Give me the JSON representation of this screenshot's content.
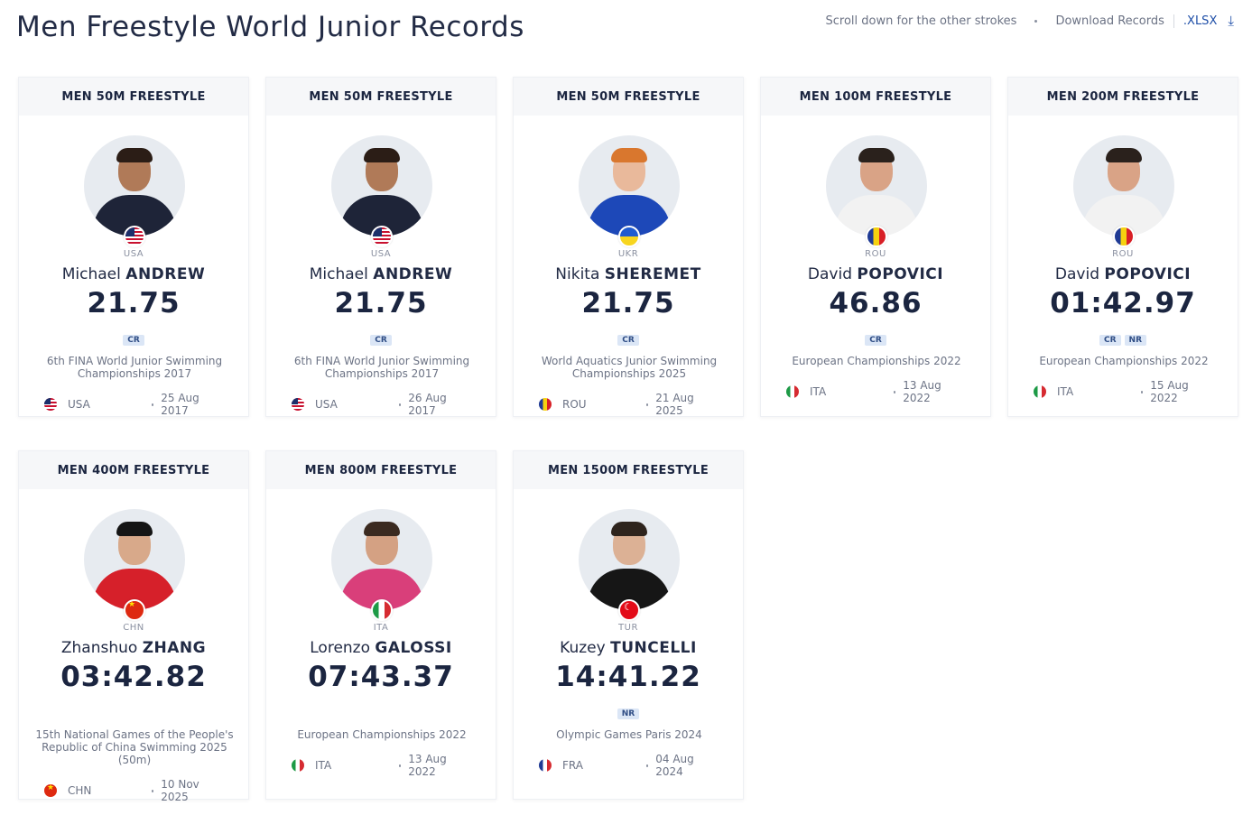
{
  "page": {
    "title": "Men Freestyle World Junior Records",
    "scroll_hint": "Scroll down for the other strokes",
    "download_label": "Download Records",
    "download_format": ".XLSX",
    "download_icon": "download-icon"
  },
  "cards": [
    {
      "discipline": "MEN 50M FREESTYLE",
      "country": "USA",
      "first": "Michael",
      "last": "ANDREW",
      "time": "21.75",
      "badges": [
        "CR"
      ],
      "event": "6th FINA World Junior Swimming Championships 2017",
      "venue_country": "USA",
      "date": "25 Aug 2017",
      "flag": "usa",
      "venue_flag": "usa",
      "skin": "#b07a58",
      "hair": "#2b1d16",
      "shirt": "#1e2438"
    },
    {
      "discipline": "MEN 50M FREESTYLE",
      "country": "USA",
      "first": "Michael",
      "last": "ANDREW",
      "time": "21.75",
      "badges": [
        "CR"
      ],
      "event": "6th FINA World Junior Swimming Championships 2017",
      "venue_country": "USA",
      "date": "26 Aug 2017",
      "flag": "usa",
      "venue_flag": "usa",
      "skin": "#b07a58",
      "hair": "#2b1d16",
      "shirt": "#1e2438"
    },
    {
      "discipline": "MEN 50M FREESTYLE",
      "country": "UKR",
      "first": "Nikita",
      "last": "SHEREMET",
      "time": "21.75",
      "badges": [
        "CR"
      ],
      "event": "World Aquatics Junior Swimming Championships 2025",
      "venue_country": "ROU",
      "date": "21 Aug 2025",
      "flag": "ukr",
      "venue_flag": "rou",
      "skin": "#e9b99b",
      "hair": "#d9772e",
      "shirt": "#1d48b8"
    },
    {
      "discipline": "MEN 100M FREESTYLE",
      "country": "ROU",
      "first": "David",
      "last": "POPOVICI",
      "time": "46.86",
      "badges": [
        "CR"
      ],
      "event": "European Championships 2022",
      "venue_country": "ITA",
      "date": "13 Aug 2022",
      "flag": "rou",
      "venue_flag": "ita",
      "skin": "#d9a386",
      "hair": "#2a211c",
      "shirt": "#f2f2f2"
    },
    {
      "discipline": "MEN 200M FREESTYLE",
      "country": "ROU",
      "first": "David",
      "last": "POPOVICI",
      "time": "01:42.97",
      "badges": [
        "CR",
        "NR"
      ],
      "event": "European Championships 2022",
      "venue_country": "ITA",
      "date": "15 Aug 2022",
      "flag": "rou",
      "venue_flag": "ita",
      "skin": "#d9a386",
      "hair": "#2a211c",
      "shirt": "#f2f2f2"
    },
    {
      "discipline": "MEN 400M FREESTYLE",
      "country": "CHN",
      "first": "Zhanshuo",
      "last": "ZHANG",
      "time": "03:42.82",
      "badges": [],
      "event": "15th National Games of the People's Republic of China Swimming 2025 (50m)",
      "venue_country": "CHN",
      "date": "10 Nov 2025",
      "flag": "chn",
      "venue_flag": "chn",
      "skin": "#d8a98a",
      "hair": "#151515",
      "shirt": "#d6202a"
    },
    {
      "discipline": "MEN 800M FREESTYLE",
      "country": "ITA",
      "first": "Lorenzo",
      "last": "GALOSSI",
      "time": "07:43.37",
      "badges": [],
      "event": "European Championships 2022",
      "venue_country": "ITA",
      "date": "13 Aug 2022",
      "flag": "ita",
      "venue_flag": "ita",
      "skin": "#d4a183",
      "hair": "#3b2a20",
      "shirt": "#d93f7a"
    },
    {
      "discipline": "MEN 1500M FREESTYLE",
      "country": "TUR",
      "first": "Kuzey",
      "last": "TUNCELLI",
      "time": "14:41.22",
      "badges": [
        "NR"
      ],
      "event": "Olympic Games Paris 2024",
      "venue_country": "FRA",
      "date": "04 Aug 2024",
      "flag": "tur",
      "venue_flag": "fra",
      "skin": "#dcb195",
      "hair": "#2e241d",
      "shirt": "#161616"
    }
  ]
}
